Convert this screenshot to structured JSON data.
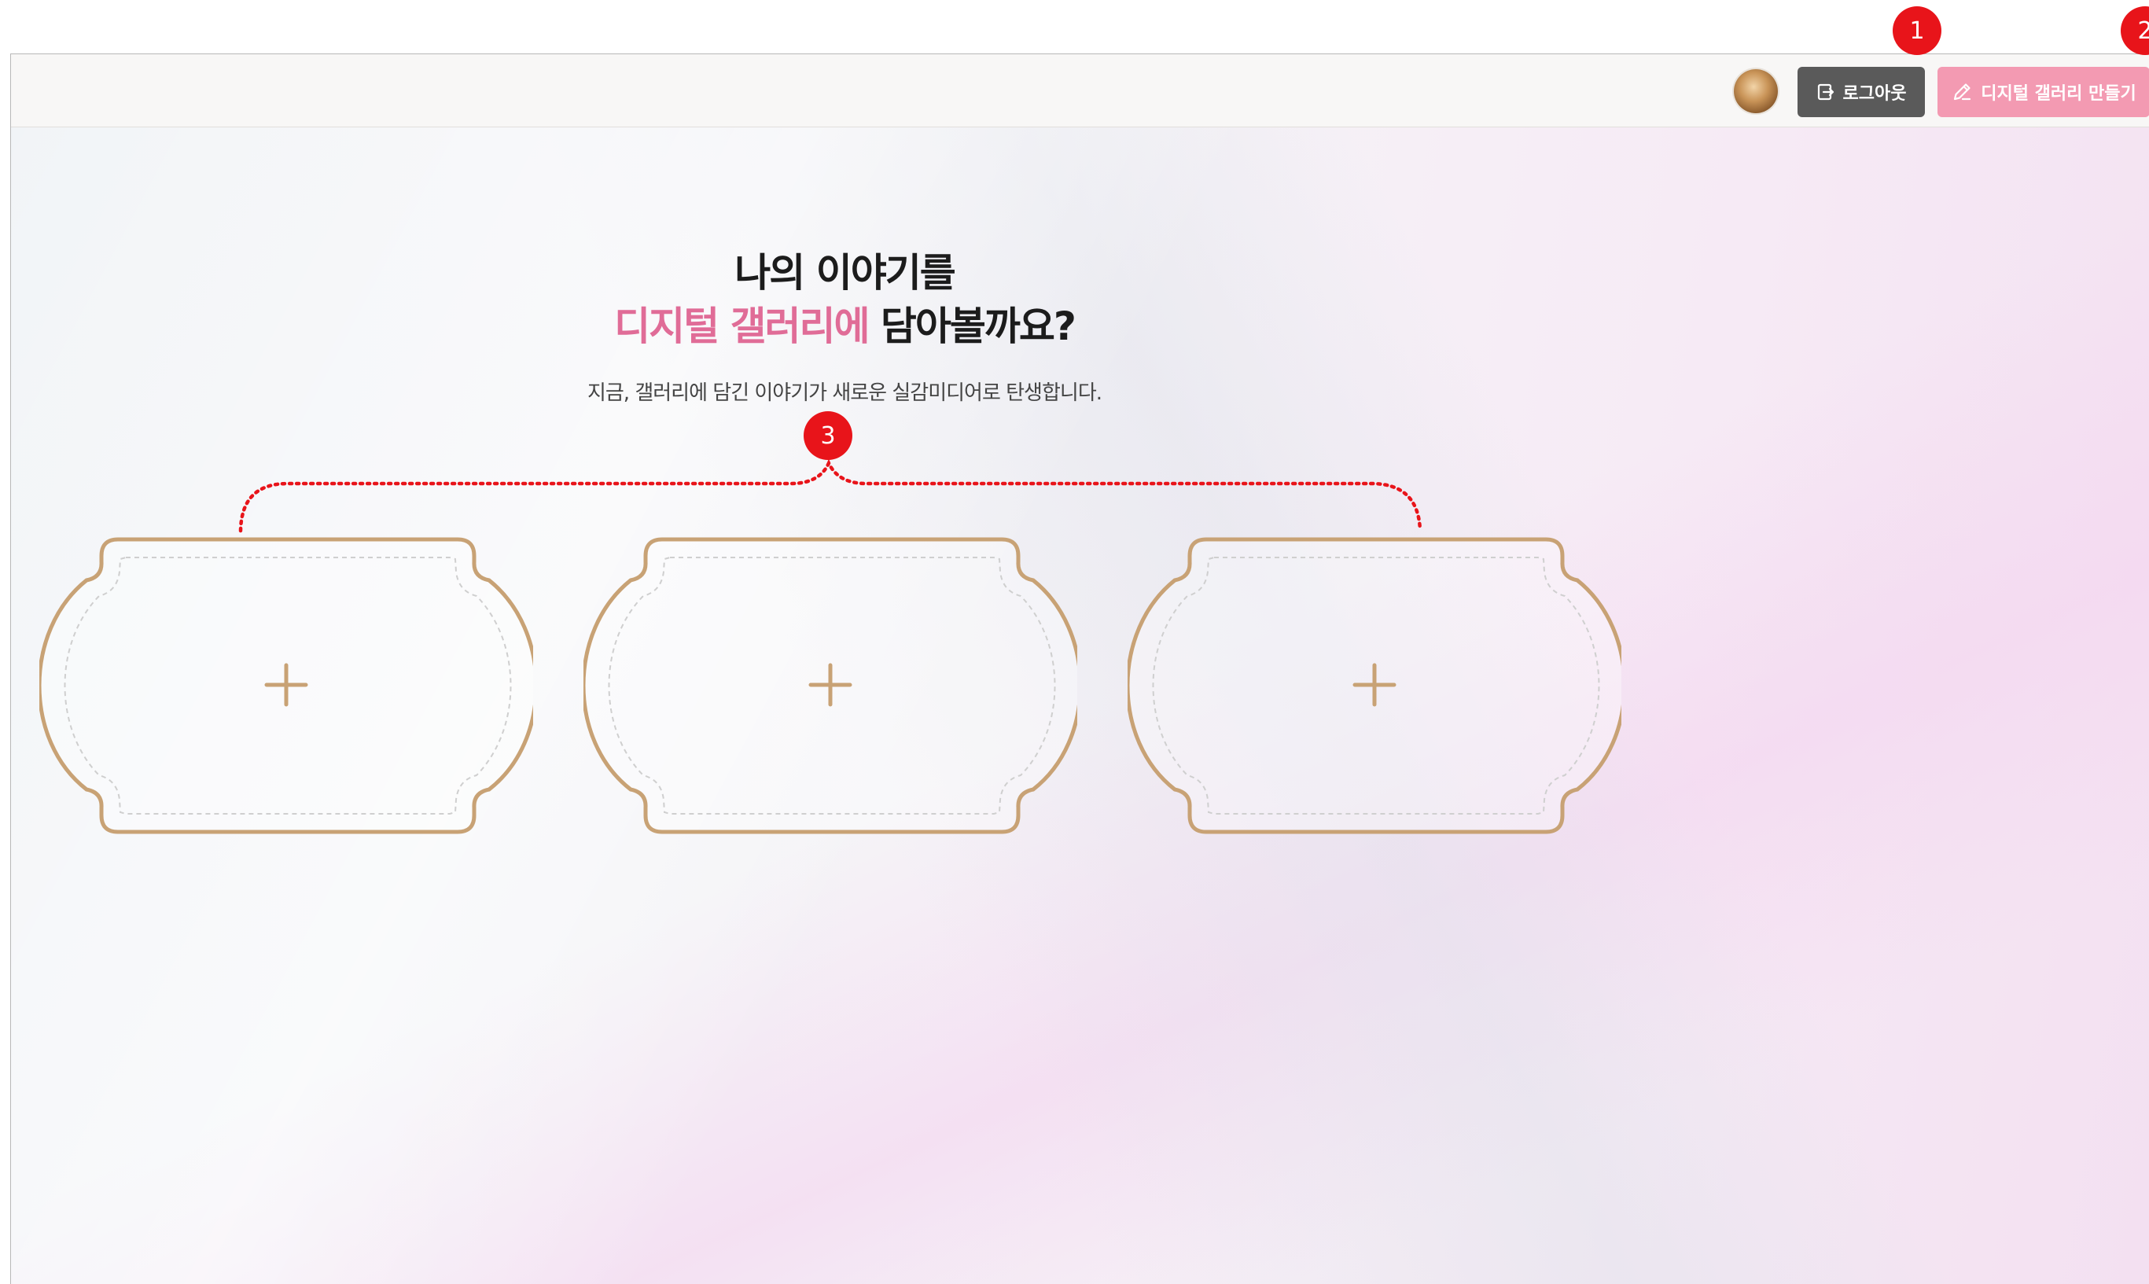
{
  "header": {
    "avatar_alt": "user-avatar",
    "logout_label": "로그아웃",
    "create_label": "디지털 갤러리 만들기"
  },
  "hero": {
    "title_line1": "나의 이야기를",
    "title_accent": "디지털 갤러리에",
    "title_rest": " 담아볼까요?",
    "subtitle": "지금, 갤러리에 담긴 이야기가 새로운 실감미디어로 탄생합니다."
  },
  "cards": [
    {
      "icon": "plus-icon"
    },
    {
      "icon": "plus-icon"
    },
    {
      "icon": "plus-icon"
    }
  ],
  "annotations": [
    "1",
    "2",
    "3"
  ],
  "colors": {
    "accent": "#e06c97",
    "create_button": "#f39ab2",
    "logout_button": "#5a5a5a",
    "frame_gold": "#c8a275",
    "annotation_red": "#e8141a"
  }
}
